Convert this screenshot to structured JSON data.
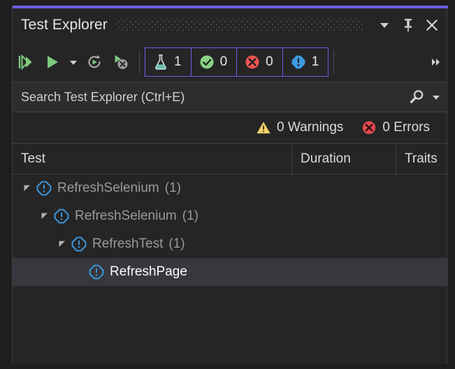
{
  "window": {
    "title": "Test Explorer",
    "accent_color": "#6c5ce7",
    "controls": [
      {
        "name": "window-menu-chevron",
        "icon": "chevron-down-icon"
      },
      {
        "name": "pin",
        "icon": "pin-icon"
      },
      {
        "name": "close",
        "icon": "close-icon"
      }
    ]
  },
  "toolbar": {
    "buttons": [
      {
        "name": "run-all-tests",
        "icon": "run-all-icon"
      },
      {
        "name": "run-tests",
        "icon": "run-icon"
      },
      {
        "name": "run-dropdown",
        "icon": "chevron-down-icon"
      },
      {
        "name": "repeat-last-run",
        "icon": "repeat-run-icon"
      },
      {
        "name": "cancel-test-run",
        "icon": "stop-run-icon"
      }
    ],
    "overflow_icon": "double-chevron-right-icon",
    "badges": [
      {
        "name": "total-tests",
        "icon": "flask-icon",
        "count": "1",
        "color": "#7fd8c9"
      },
      {
        "name": "passed-tests",
        "icon": "check-circle-icon",
        "count": "0",
        "color": "#89d185"
      },
      {
        "name": "failed-tests",
        "icon": "error-circle-icon",
        "count": "0",
        "color": "#f05454"
      },
      {
        "name": "not-run-tests",
        "icon": "not-run-icon",
        "count": "1",
        "color": "#3f9ae0"
      }
    ]
  },
  "search": {
    "placeholder": "Search Test Explorer (Ctrl+E)",
    "value": "",
    "icon": "search-icon",
    "dropdown_icon": "chevron-down-icon"
  },
  "status": {
    "warnings": {
      "icon": "warning-triangle-icon",
      "label": "0 Warnings",
      "color": "#f3d36b"
    },
    "errors": {
      "icon": "error-circle-icon",
      "label": "0 Errors",
      "color": "#e5484d"
    }
  },
  "columns": [
    {
      "name": "test",
      "label": "Test"
    },
    {
      "name": "duration",
      "label": "Duration"
    },
    {
      "name": "traits",
      "label": "Traits"
    }
  ],
  "tree": {
    "rows": [
      {
        "name": "tree-row-refreshselenium-assembly",
        "label": "RefreshSelenium",
        "count": "(1)",
        "level": 0,
        "expanded": true,
        "icon": "not-run-icon",
        "selected": false
      },
      {
        "name": "tree-row-refreshselenium-namespace",
        "label": "RefreshSelenium",
        "count": "(1)",
        "level": 1,
        "expanded": true,
        "icon": "not-run-icon",
        "selected": false
      },
      {
        "name": "tree-row-refreshtest-class",
        "label": "RefreshTest",
        "count": "(1)",
        "level": 2,
        "expanded": true,
        "icon": "not-run-icon",
        "selected": false
      },
      {
        "name": "tree-row-refreshpage-test",
        "label": "RefreshPage",
        "count": "",
        "level": 3,
        "expanded": false,
        "icon": "not-run-icon",
        "selected": true
      }
    ]
  }
}
